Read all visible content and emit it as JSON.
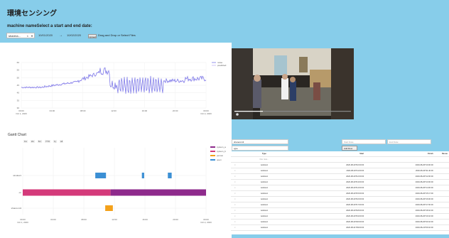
{
  "page": {
    "title": "環境センシング",
    "subtitle": "machine nameSelect a start and end date:"
  },
  "controls": {
    "machine_select": "sharera...",
    "clear_glyph": "×",
    "chevron_glyph": "▾",
    "start_date": "10/01/2020",
    "arrow": "→",
    "end_date": "10/02/2020",
    "upload_label": "Upload",
    "drop_text": "Drag and Drop or Select Files"
  },
  "line_chart": {
    "chart_data": {
      "type": "line",
      "x_ticks": [
        "00:00\nOct 1, 2020",
        "04:00",
        "08:00",
        "12:00",
        "16:00",
        "20:00",
        "00:00\nOct 2, 2020"
      ],
      "y_ticks": [
        "60",
        "55",
        "50",
        "45",
        "40",
        "35",
        "30"
      ],
      "ylim": [
        28,
        62
      ],
      "legend": [
        "noise",
        "predicted"
      ],
      "colors": [
        "#7b78e8",
        "#c4b5f2"
      ]
    }
  },
  "gantt": {
    "title": "Gantt Chart",
    "range_buttons": [
      "1w",
      "2w",
      "6m",
      "YTD",
      "1y",
      "all"
    ],
    "chart_data": {
      "type": "bar",
      "rows": [
        "window1",
        "on",
        "sharerom3"
      ],
      "x_ticks": [
        "00:00\nOct 1, 2020",
        "04:00",
        "08:00",
        "12:00",
        "16:00",
        "20:00",
        "00:00\nOct 2, 2020"
      ],
      "legend": [
        "system_a",
        "system_b",
        "person",
        "open"
      ],
      "colors": [
        "#8e2a8c",
        "#d43a7a",
        "#f4a11a",
        "#3b8fd4"
      ],
      "bars": [
        {
          "row": "window1",
          "start": 9.5,
          "end": 10.9,
          "color": "#3b8fd4"
        },
        {
          "row": "window1",
          "start": 15.6,
          "end": 15.9,
          "color": "#3b8fd4"
        },
        {
          "row": "window1",
          "start": 19.0,
          "end": 19.5,
          "color": "#3b8fd4"
        },
        {
          "row": "on",
          "start": 0,
          "end": 11.5,
          "color": "#d43a7a"
        },
        {
          "row": "on",
          "start": 11.5,
          "end": 24,
          "color": "#8e2a8c"
        },
        {
          "row": "sharerom3",
          "start": 10.8,
          "end": 11.8,
          "color": "#f4a11a"
        }
      ]
    }
  },
  "filters": {
    "room_value": "sharerom3",
    "event_value": "type",
    "start_placeholder": "Start Date",
    "end_placeholder": "End Date",
    "add_row_label": "Add Row"
  },
  "table": {
    "headers": [
      "",
      "Type",
      "Start",
      "Finish",
      "Resou"
    ],
    "filter_row": [
      "",
      "filter data...",
      "",
      "",
      ""
    ],
    "rows": [
      [
        "×",
        "window1",
        "2020-08-20T10:00:00",
        "2020-08-20T10:00:00",
        ""
      ],
      [
        "×",
        "window1",
        "2020-08-20T11:00:00",
        "2020-08-20T11:40:00",
        ""
      ],
      [
        "×",
        "window1",
        "2020-08-20T12:00:00",
        "2020-08-20T12:00:00",
        ""
      ],
      [
        "×",
        "window1",
        "2020-08-20T13:00:00",
        "2020-08-20T13:00:00",
        ""
      ],
      [
        "×",
        "window1",
        "2020-08-20T14:00:00",
        "2020-08-20T14:00:00",
        ""
      ],
      [
        "×",
        "window1",
        "2020-08-20T15:00:00",
        "2020-08-20T15:17:00",
        ""
      ],
      [
        "×",
        "window1",
        "2020-08-20T16:00:00",
        "2020-08-20T16:00:00",
        ""
      ],
      [
        "×",
        "window1",
        "2020-08-20T17:00:00",
        "2020-08-20T17:00:00",
        ""
      ],
      [
        "×",
        "window1",
        "2020-08-20T18:00:00",
        "2020-08-20T18:10:00",
        ""
      ],
      [
        "×",
        "window1",
        "2020-08-20T19:00:00",
        "2020-08-20T19:10:00",
        ""
      ],
      [
        "×",
        "window1",
        "2020-08-20T20:00:00",
        "2020-08-20T20:10:00",
        ""
      ],
      [
        "×",
        "window1",
        "2020-08-21T09:00:00",
        "2020-08-21T09:10:00",
        ""
      ]
    ]
  }
}
